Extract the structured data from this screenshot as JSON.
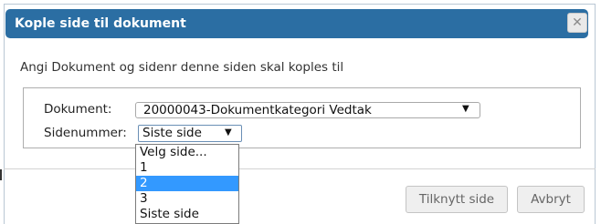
{
  "dialog": {
    "title": "Kople side til dokument",
    "close_icon": "close-icon",
    "instruction": "Angi Dokument og sidenr denne siden skal koples til"
  },
  "form": {
    "document_label": "Dokument:",
    "document_value": "20000043-Dokumentkategori Vedtak",
    "page_label": "Sidenummer:",
    "page_value": "Siste side"
  },
  "dropdown": {
    "options": [
      "Velg side...",
      "1",
      "2",
      "3",
      "Siste side"
    ],
    "highlighted": "2"
  },
  "buttons": {
    "attach": "Tilknytt side",
    "cancel": "Avbryt"
  }
}
